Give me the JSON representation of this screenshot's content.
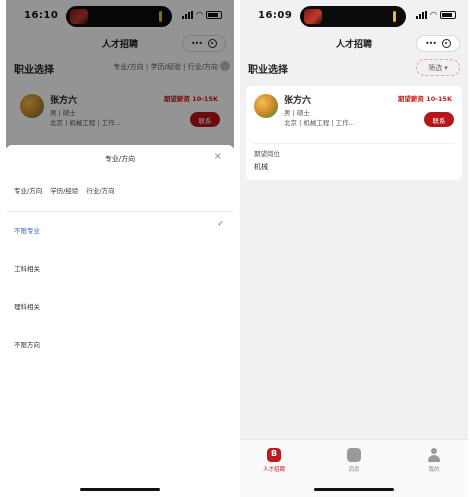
{
  "left": {
    "status": {
      "time": "16:10"
    },
    "nav_title": "人才招聘",
    "section_heading": "职业选择",
    "section_filters": "专业/方向 | 学历/经验 | 行业/方向",
    "card": {
      "name": "张方六",
      "line1": "男 | 硕士",
      "line2": "北京 | 机械工程 | 工作...",
      "tag": "期望薪资 10-15K",
      "button": "联系"
    },
    "sheet": {
      "title": "专业/方向",
      "close": "×",
      "tabs": [
        "专业/方向",
        "学历/经验",
        "行业/方向"
      ],
      "options": [
        "不限专业",
        "工科相关",
        "理科相关",
        "不限方向"
      ],
      "selected_index": 0
    }
  },
  "right": {
    "status": {
      "time": "16:09"
    },
    "nav_title": "人才招聘",
    "section_heading": "职业选择",
    "filter_pill": "筛选",
    "card": {
      "name": "张方六",
      "line1": "男 | 硕士",
      "line2": "北京 | 机械工程 | 工作...",
      "tag": "期望薪资 10-15K",
      "button": "联系",
      "extra_label": "期望岗位",
      "extra_value": "机械"
    },
    "tabbar": [
      {
        "label": "人才招聘",
        "icon": "home-icon",
        "active": true
      },
      {
        "label": "消息",
        "icon": "chat-icon",
        "active": false
      },
      {
        "label": "我的",
        "icon": "user-icon",
        "active": false
      }
    ]
  },
  "colors": {
    "accent": "#b8141c",
    "selected_text": "#2c62c9",
    "page_bg_right": "#f1f1f3"
  }
}
